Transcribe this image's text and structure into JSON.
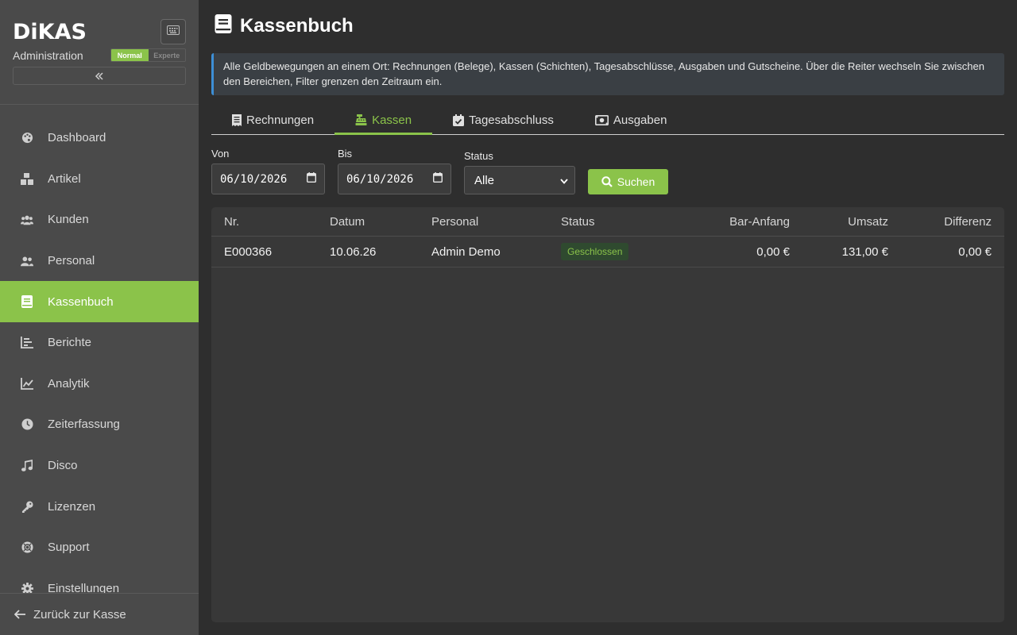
{
  "sidebar": {
    "logo": "DiKAS",
    "subtitle": "Administration",
    "mode_normal": "Normal",
    "mode_experte": "Experte",
    "items": [
      {
        "label": "Dashboard",
        "icon": "palette-icon"
      },
      {
        "label": "Artikel",
        "icon": "boxes-icon"
      },
      {
        "label": "Kunden",
        "icon": "users-icon"
      },
      {
        "label": "Personal",
        "icon": "user-group-icon"
      },
      {
        "label": "Kassenbuch",
        "icon": "book-icon",
        "active": true
      },
      {
        "label": "Berichte",
        "icon": "bar-chart-icon"
      },
      {
        "label": "Analytik",
        "icon": "line-chart-icon"
      },
      {
        "label": "Zeiterfassung",
        "icon": "clock-icon"
      },
      {
        "label": "Disco",
        "icon": "music-icon"
      },
      {
        "label": "Lizenzen",
        "icon": "key-icon"
      },
      {
        "label": "Support",
        "icon": "lifebuoy-icon"
      },
      {
        "label": "Einstellungen",
        "icon": "gear-icon"
      }
    ],
    "back_label": "Zurück zur Kasse"
  },
  "header": {
    "title": "Kassenbuch"
  },
  "info": "Alle Geldbewegungen an einem Ort: Rechnungen (Belege), Kassen (Schichten), Tagesabschlüsse, Ausgaben und Gutscheine. Über die Reiter wechseln Sie zwischen den Bereichen, Filter grenzen den Zeitraum ein.",
  "tabs": [
    {
      "label": "Rechnungen",
      "icon": "receipt-icon"
    },
    {
      "label": "Kassen",
      "icon": "cash-register-icon",
      "active": true
    },
    {
      "label": "Tagesabschluss",
      "icon": "calendar-check-icon"
    },
    {
      "label": "Ausgaben",
      "icon": "money-bill-icon"
    }
  ],
  "filters": {
    "von_label": "Von",
    "von_value": "06/10/2026",
    "bis_label": "Bis",
    "bis_value": "06/10/2026",
    "status_label": "Status",
    "status_value": "Alle",
    "search_label": "Suchen"
  },
  "table": {
    "columns": [
      "Nr.",
      "Datum",
      "Personal",
      "Status",
      "Bar-Anfang",
      "Umsatz",
      "Differenz"
    ],
    "rows": [
      {
        "nr": "E000366",
        "datum": "10.06.26",
        "personal": "Admin Demo",
        "status": "Geschlossen",
        "bar_anfang": "0,00 €",
        "umsatz": "131,00 €",
        "differenz": "0,00 €"
      }
    ]
  },
  "colors": {
    "accent": "#8bc34a",
    "info_border": "#3d8fd6",
    "sidebar_bg": "#4a4a4a",
    "main_bg": "#2e2e2e"
  }
}
